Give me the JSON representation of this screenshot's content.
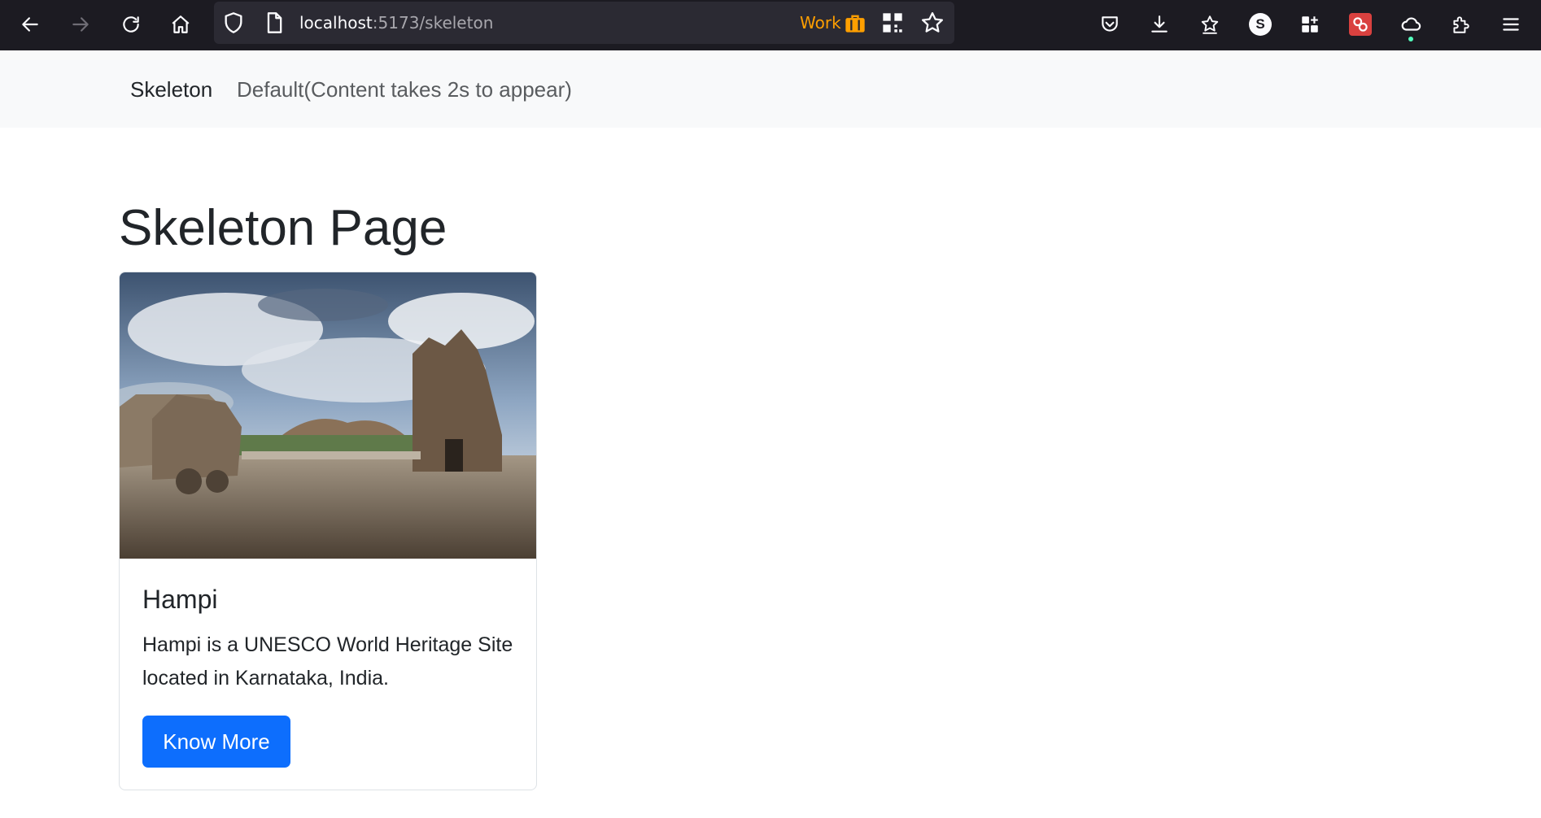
{
  "browser": {
    "url_host": "localhost",
    "url_path": ":5173/skeleton",
    "container_label": "Work",
    "profile_initial": "S"
  },
  "navbar": {
    "brand": "Skeleton",
    "link": "Default(Content takes 2s to appear)"
  },
  "page": {
    "title": "Skeleton Page"
  },
  "card": {
    "title": "Hampi",
    "text": "Hampi is a UNESCO World Heritage Site located in Karnataka, India.",
    "button_label": "Know More",
    "image_alt": "Stone chariot and temple at Hampi"
  },
  "colors": {
    "toolbar_bg": "#1c1b22",
    "urlbar_bg": "#2b2a33",
    "container_accent": "#ff9f00",
    "navbar_bg": "#f8f9fa",
    "primary": "#0d6efd"
  }
}
